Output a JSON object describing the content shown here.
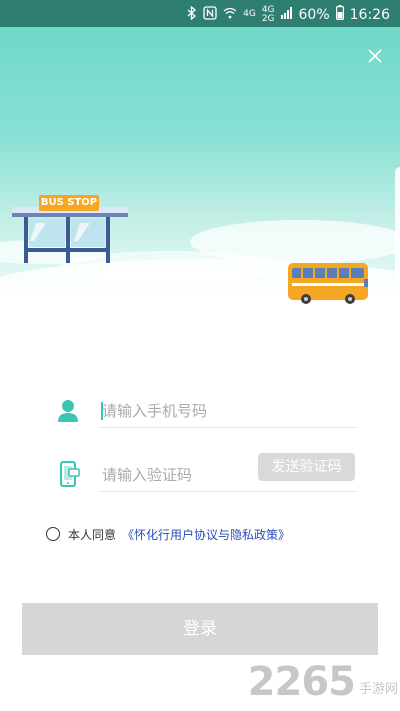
{
  "status_bar": {
    "network_4g_1": "4G",
    "network_4g_2": "4G",
    "network_2g": "2G",
    "battery": "60%",
    "time": "16:26",
    "icons": [
      "bluetooth-icon",
      "nfc-icon",
      "wifi-icon",
      "signal-icon",
      "battery-icon"
    ]
  },
  "hero": {
    "bus_stop_sign": "BUS STOP"
  },
  "form": {
    "phone_placeholder": "请输入手机号码",
    "code_placeholder": "请输入验证码",
    "send_code_label": "发送验证码"
  },
  "agreement": {
    "prefix": "本人同意",
    "link_text": "《怀化行用户协议与隐私政策》",
    "checked": false
  },
  "login_label": "登录",
  "watermark": {
    "number": "2265",
    "suffix": "手游网"
  },
  "colors": {
    "accent": "#39c6b3",
    "status_bar": "#2f7e72",
    "link": "#2a4db8",
    "button_disabled": "#d6d6d6"
  }
}
